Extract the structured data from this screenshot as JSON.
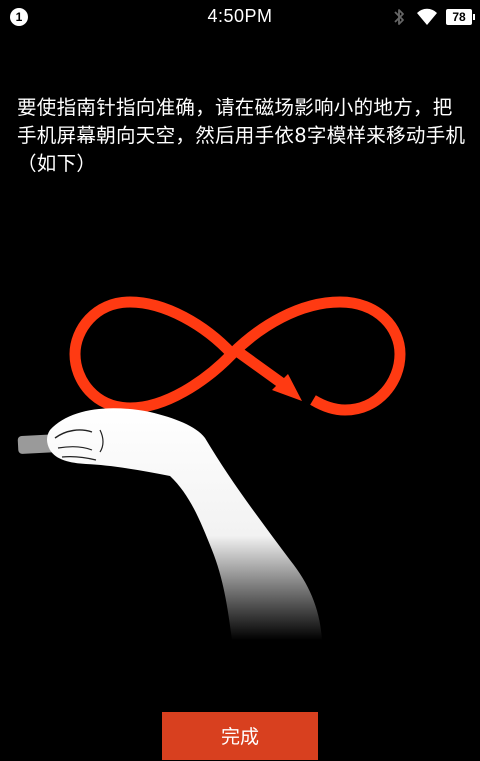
{
  "status_bar": {
    "notification_count": "1",
    "time": "4:50PM",
    "battery_level": "78",
    "icons": [
      "notification-badge-icon",
      "bluetooth-icon",
      "wifi-icon",
      "battery-icon"
    ]
  },
  "instruction": {
    "text": "要使指南针指向准确，请在磁场影响小的地方，把手机屏幕朝向天空，然后用手依8字模样来移动手机（如下）"
  },
  "illustration": {
    "icon": "figure-eight-arrow-icon",
    "accent_color": "#ff3a12"
  },
  "actions": {
    "done_label": "完成",
    "done_color": "#d8401f"
  }
}
